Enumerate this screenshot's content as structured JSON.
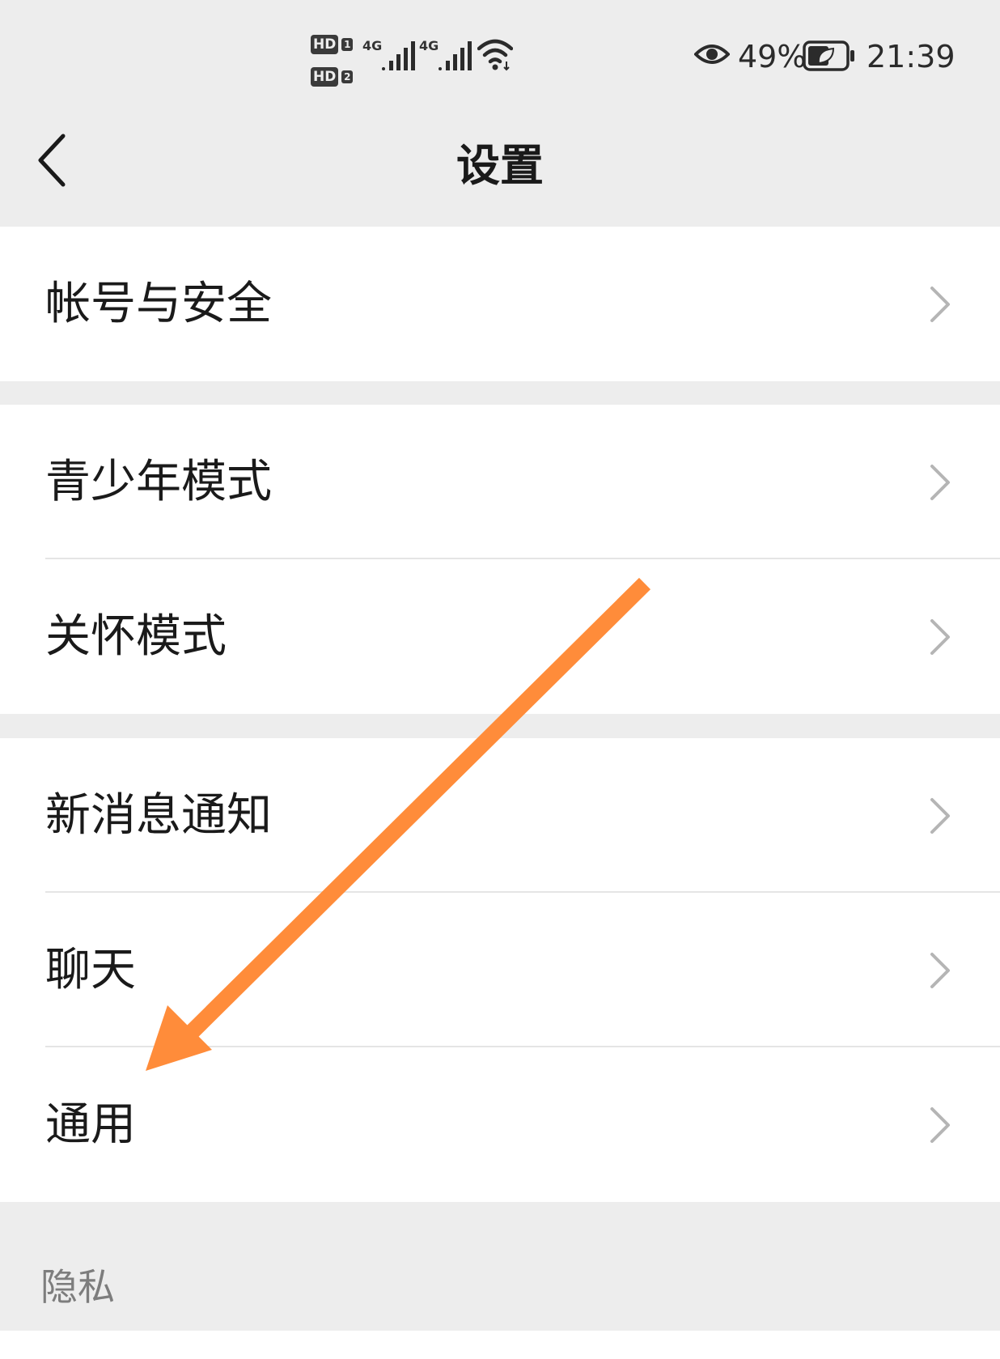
{
  "status_bar": {
    "hd1": "HD",
    "hd1_index": "1",
    "hd2": "HD",
    "hd2_index": "2",
    "sim1_network": "4G",
    "sim2_network": "4G",
    "battery_percent": "49%",
    "time": "21:39",
    "icons": [
      "hd-icon",
      "signal-icon",
      "wifi-icon",
      "eye-comfort-icon",
      "battery-icon"
    ]
  },
  "nav": {
    "title": "设置",
    "back_icon": "chevron-left-icon"
  },
  "groups": [
    {
      "items": [
        {
          "label": "帐号与安全"
        }
      ]
    },
    {
      "items": [
        {
          "label": "青少年模式"
        },
        {
          "label": "关怀模式"
        }
      ]
    },
    {
      "items": [
        {
          "label": "新消息通知"
        },
        {
          "label": "聊天"
        },
        {
          "label": "通用"
        }
      ]
    }
  ],
  "section_header": "隐私",
  "colors": {
    "background": "#ededed",
    "row_background": "#ffffff",
    "annotation_arrow": "#ff8c3a"
  }
}
